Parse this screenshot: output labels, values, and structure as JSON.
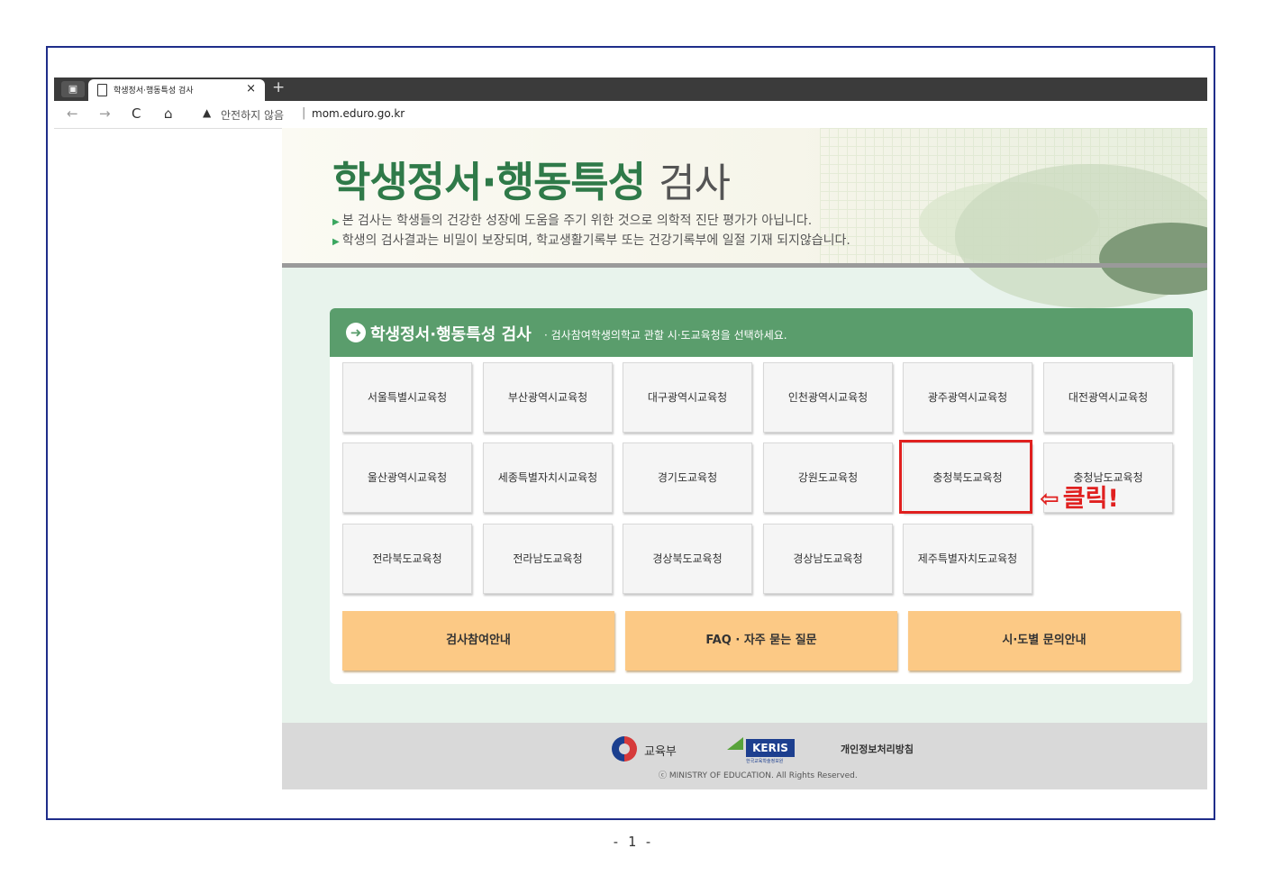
{
  "browser": {
    "tab_title": "학생정서·행동특성 검사",
    "tab_close": "×",
    "new_tab": "+",
    "back": "←",
    "forward": "→",
    "reload": "C",
    "home": "⌂",
    "warning_icon": "▲",
    "insecure_label": "안전하지 않음",
    "separator": "|",
    "url": "mom.eduro.go.kr"
  },
  "hero": {
    "title_bold": "학생정서·행동특성",
    "title_light": "검사",
    "bullet": "▶",
    "lines": [
      "본 검사는 학생들의 건강한 성장에 도움을 주기 위한 것으로 의학적 진단 평가가 아닙니다.",
      "학생의 검사결과는 비밀이 보장되며, 학교생활기록부 또는 건강기록부에 일절 기재 되지않습니다."
    ]
  },
  "panel": {
    "arrow": "➜",
    "title": "학생정서·행동특성 검사",
    "subtitle": "· 검사참여학생의학교 관할 시·도교육청을 선택하세요.",
    "offices": [
      "서울특별시교육청",
      "부산광역시교육청",
      "대구광역시교육청",
      "인천광역시교육청",
      "광주광역시교육청",
      "대전광역시교육청",
      "울산광역시교육청",
      "세종특별자치시교육청",
      "경기도교육청",
      "강원도교육청",
      "충청북도교육청",
      "충청남도교육청",
      "전라북도교육청",
      "전라남도교육청",
      "경상북도교육청",
      "경상남도교육청",
      "제주특별자치도교육청"
    ],
    "info_buttons": [
      "검사참여안내",
      "FAQ · 자주 묻는 질문",
      "시·도별 문의안내"
    ]
  },
  "footer": {
    "moe": "교육부",
    "keris": "KERIS",
    "keris_sub": "한국교육학술정보원",
    "privacy": "개인정보처리방침",
    "copyright": "ⓒ MINISTRY OF EDUCATION. All Rights Reserved."
  },
  "annotation": {
    "arrow": "⇦",
    "label": "클릭!",
    "highlight_color": "#e0201f"
  },
  "page_number": "- 1 -",
  "colors": {
    "accent_green": "#5a9d6c",
    "title_green": "#2f7a49",
    "info_orange": "#fcc985",
    "frame_blue": "#1f2d8a"
  }
}
